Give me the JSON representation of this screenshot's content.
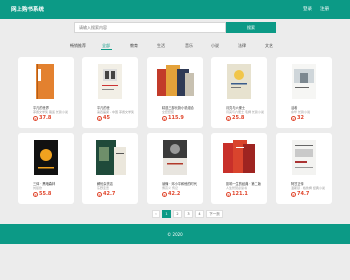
{
  "header": {
    "logo": "网上购书系统",
    "nav": [
      "登录",
      "注册"
    ]
  },
  "search": {
    "placeholder": "请输入搜索内容",
    "button": "搜索"
  },
  "categories": {
    "items": [
      "畅销推荐",
      "全部",
      "教育",
      "生活",
      "音乐",
      "小说",
      "法律",
      "文艺"
    ],
    "active_index": 1
  },
  "books": [
    {
      "title": "平凡的世界",
      "desc": "茅盾文学奖 路遥 长篇小说",
      "price": "37.8",
      "coin": "¥"
    },
    {
      "title": "平凡的世",
      "desc": "第四届梁 - 中国 茅盾文学奖",
      "price": "45",
      "coin": "¥"
    },
    {
      "title": "精选三部长篇小说组合",
      "desc": "全套套装",
      "price": "115.9",
      "coin": "¥"
    },
    {
      "title": "月亮与六便士",
      "desc": "月亮与六便士 毛姆 长篇小说",
      "price": "25.8",
      "coin": "¥"
    },
    {
      "title": "活着",
      "desc": "余华 长篇小说",
      "price": "32",
      "coin": "¥"
    },
    {
      "title": "三体 · 黑暗森林",
      "desc": "刘慈欣",
      "price": "55.8",
      "coin": "¥"
    },
    {
      "title": "解忧杂货店",
      "desc": "东野圭吾",
      "price": "42.7",
      "coin": "¥"
    },
    {
      "title": "读懂 · 邓小平和他的时代",
      "desc": "傅高义 传记",
      "price": "42.2",
      "coin": "¥"
    },
    {
      "title": "影响一生的经典 · 第二版",
      "desc": "人生智慧必读书",
      "price": "121.1",
      "coin": "¥"
    },
    {
      "title": "阿甘正传",
      "desc": "温斯顿 · 格鲁姆 经典小说",
      "price": "74.7",
      "coin": "¥"
    }
  ],
  "pagination": {
    "prev": "‹",
    "pages": [
      "1",
      "2",
      "3",
      "4"
    ],
    "next": "下一页",
    "current": "1"
  },
  "footer": {
    "text": "© 2020"
  },
  "colors": {
    "accent": "#0c9a86",
    "price": "#e0452b"
  }
}
